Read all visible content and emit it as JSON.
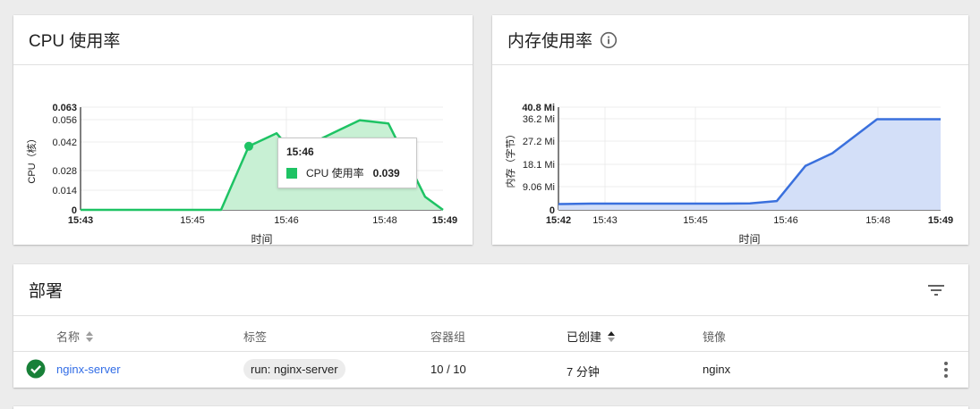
{
  "cpu_card": {
    "title": "CPU 使用率",
    "tooltip": {
      "time": "15:46",
      "series_label": "CPU 使用率",
      "value": "0.039"
    }
  },
  "mem_card": {
    "title": "内存使用率",
    "info_icon": "info-icon"
  },
  "chart_data": [
    {
      "type": "area",
      "title": "CPU 使用率",
      "xlabel": "时间",
      "ylabel": "CPU（核）",
      "ylim": [
        0,
        0.063
      ],
      "yticks": [
        "0",
        "0.014",
        "0.028",
        "0.042",
        "0.056",
        "0.063"
      ],
      "xticks": [
        "15:43",
        "15:45",
        "15:46",
        "15:48",
        "15:49"
      ],
      "x": [
        "15:43",
        "15:43:40",
        "15:44:20",
        "15:45:00",
        "15:45:20",
        "15:45:50",
        "15:46:10",
        "15:46:30",
        "15:47:00",
        "15:47:30",
        "15:47:45",
        "15:48:30",
        "15:49:00"
      ],
      "values": [
        0,
        0,
        0,
        0,
        0,
        0.039,
        0.047,
        0.027,
        0.044,
        0.055,
        0.053,
        0.008,
        0
      ],
      "color": "#1ec364",
      "fill": "#c8f0d4",
      "grid": true
    },
    {
      "type": "area",
      "title": "内存使用率",
      "xlabel": "时间",
      "ylabel": "内存（字节）",
      "ylim": [
        0,
        40.8
      ],
      "yticks": [
        "0",
        "9.06 Mi",
        "18.1 Mi",
        "27.2 Mi",
        "36.2 Mi",
        "40.8 Mi"
      ],
      "xticks": [
        "15:42",
        "15:43",
        "15:45",
        "15:46",
        "15:48",
        "15:49"
      ],
      "values": [
        2.3,
        2.5,
        2.5,
        2.5,
        2.6,
        3.5,
        17.5,
        22.5,
        36,
        36,
        36,
        36
      ],
      "color": "#3a70dd",
      "fill": "#d3dff8",
      "grid": true
    }
  ],
  "deployments": {
    "title": "部署",
    "filter_icon": "filter-icon",
    "columns": {
      "name": "名称",
      "labels": "标签",
      "pods": "容器组",
      "created": "已创建",
      "images": "镜像"
    },
    "rows": [
      {
        "status_icon": "check-circle-icon",
        "name": "nginx-server",
        "label": "run: nginx-server",
        "pods": "10 / 10",
        "created": "7 分钟",
        "image": "nginx",
        "status_color": "#188038"
      }
    ]
  }
}
